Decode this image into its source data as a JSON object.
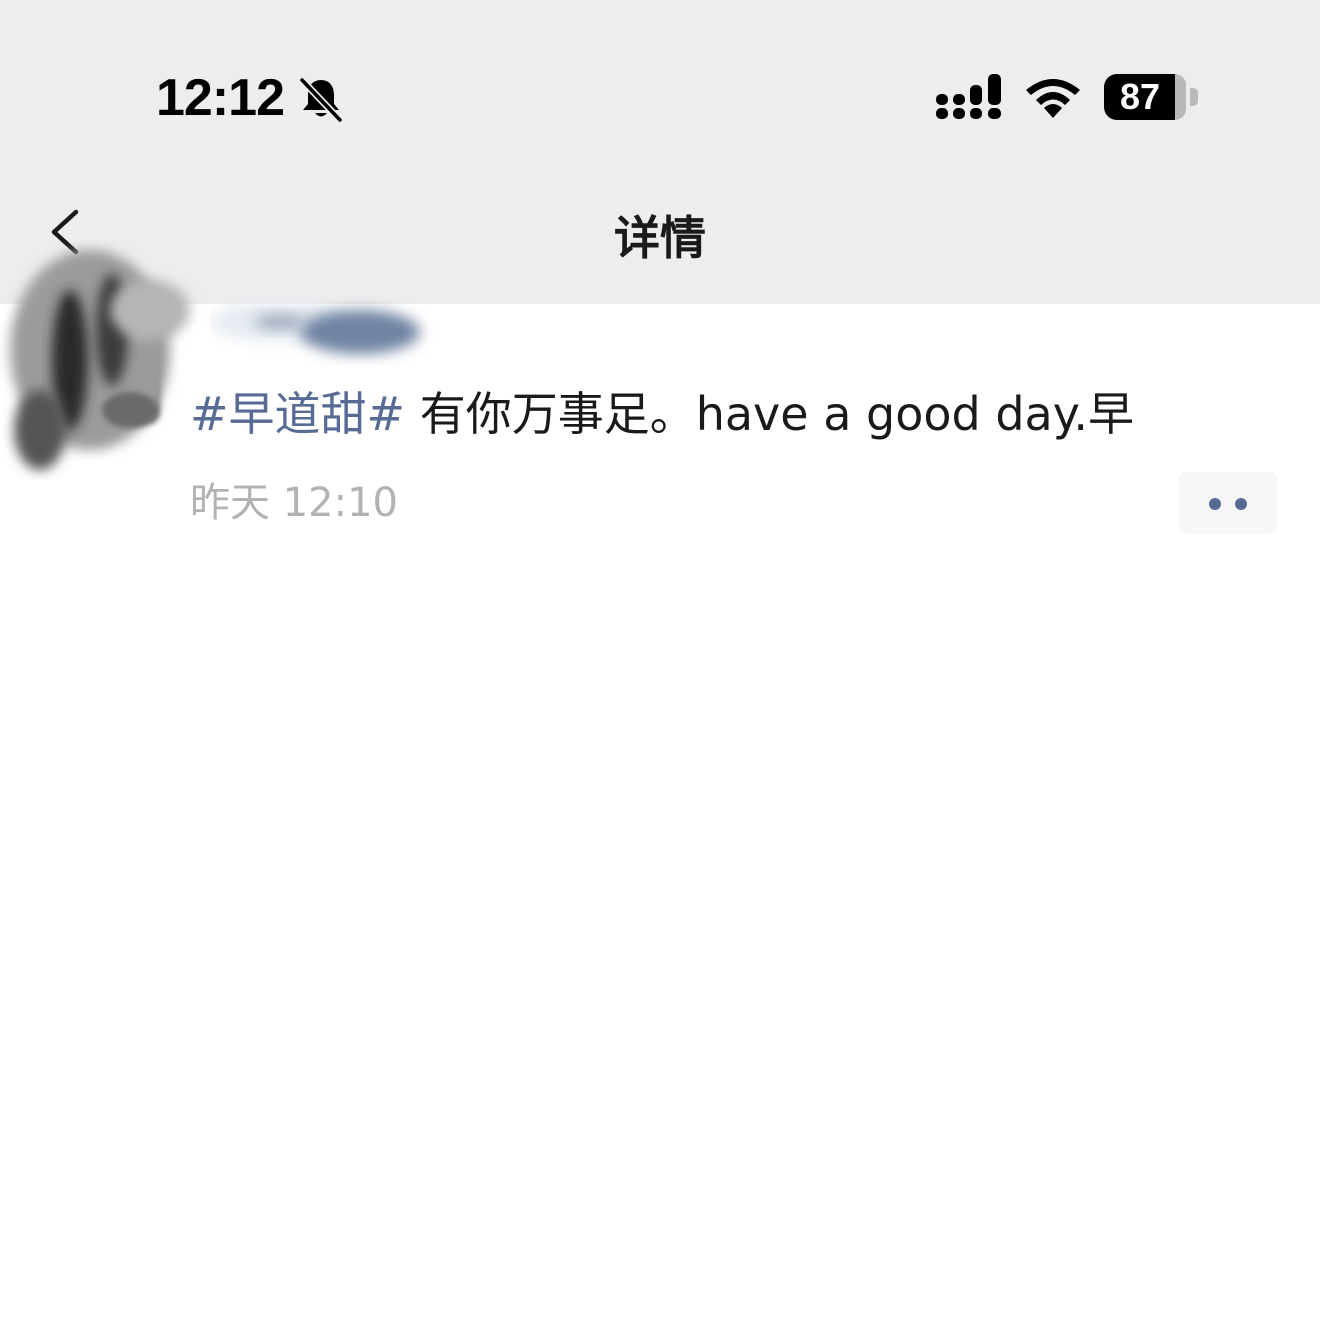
{
  "status_bar": {
    "time": "12:12",
    "battery_percent": "87",
    "icons": [
      "mute-bell-icon",
      "cellular-signal-icon",
      "wifi-icon",
      "battery-icon"
    ]
  },
  "nav": {
    "title": "详情",
    "back_icon": "chevron-left-icon"
  },
  "post": {
    "topic": "#早道甜#",
    "text": " 有你万事足。have a good day.早",
    "time": "昨天 12:10",
    "more_icon": "more-dots-icon"
  },
  "colors": {
    "header_bg": "#ededed",
    "link": "#576b95",
    "meta_text": "#b2b2b2",
    "body_text": "#1a1a1a"
  }
}
